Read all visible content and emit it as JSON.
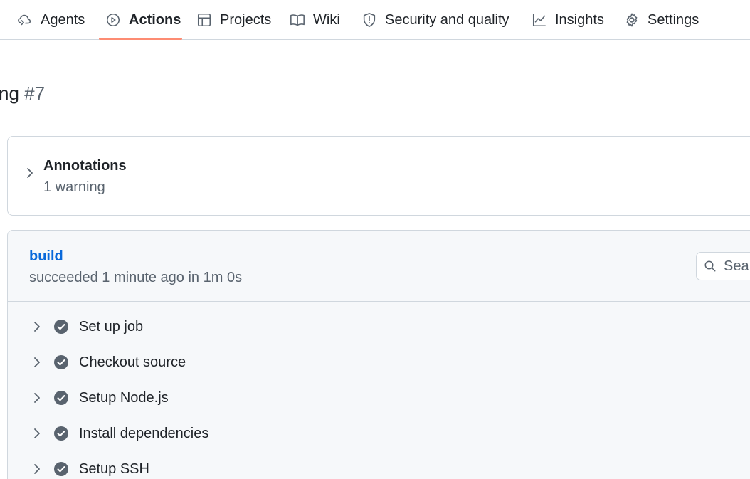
{
  "nav": {
    "tabs": [
      {
        "label": "Agents",
        "icon": "agents-icon"
      },
      {
        "label": "Actions",
        "icon": "play-circle-icon",
        "active": true
      },
      {
        "label": "Projects",
        "icon": "table-icon"
      },
      {
        "label": "Wiki",
        "icon": "book-icon"
      },
      {
        "label": "Security and quality",
        "icon": "shield-icon"
      },
      {
        "label": "Insights",
        "icon": "graph-icon"
      },
      {
        "label": "Settings",
        "icon": "gear-icon"
      }
    ]
  },
  "run": {
    "title_fragment": "ng",
    "number": "#7"
  },
  "annotations": {
    "title": "Annotations",
    "summary": "1 warning"
  },
  "job": {
    "name": "build",
    "meta": "succeeded 1 minute ago in 1m 0s",
    "search_placeholder": "Search logs",
    "steps": [
      {
        "label": "Set up job",
        "status": "success"
      },
      {
        "label": "Checkout source",
        "status": "success"
      },
      {
        "label": "Setup Node.js",
        "status": "success"
      },
      {
        "label": "Install dependencies",
        "status": "success"
      },
      {
        "label": "Setup SSH",
        "status": "success"
      }
    ]
  },
  "colors": {
    "accent_underline": "#fd8c73",
    "link": "#0969da",
    "success_check": "#59636e"
  }
}
